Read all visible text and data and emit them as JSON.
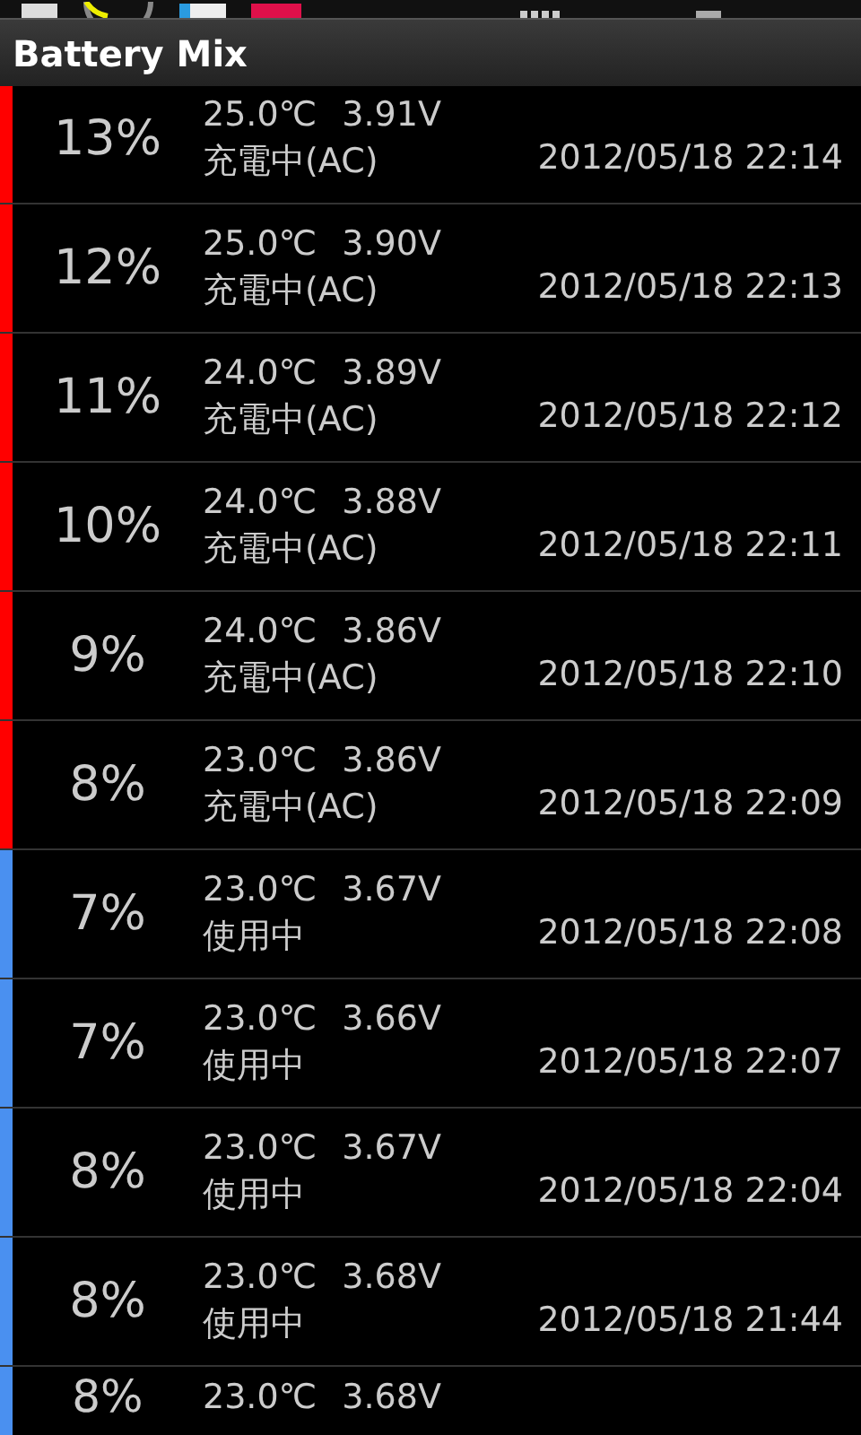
{
  "window": {
    "title": "Battery Mix"
  },
  "records": [
    {
      "percent": "13%",
      "temperature": "25.0℃",
      "voltage": "3.91V",
      "status": "充電中(AC)",
      "time": "2012/05/18 22:14",
      "color": "#ff0000"
    },
    {
      "percent": "12%",
      "temperature": "25.0℃",
      "voltage": "3.90V",
      "status": "充電中(AC)",
      "time": "2012/05/18 22:13",
      "color": "#ff0000"
    },
    {
      "percent": "11%",
      "temperature": "24.0℃",
      "voltage": "3.89V",
      "status": "充電中(AC)",
      "time": "2012/05/18 22:12",
      "color": "#ff0000"
    },
    {
      "percent": "10%",
      "temperature": "24.0℃",
      "voltage": "3.88V",
      "status": "充電中(AC)",
      "time": "2012/05/18 22:11",
      "color": "#ff0000"
    },
    {
      "percent": "9%",
      "temperature": "24.0℃",
      "voltage": "3.86V",
      "status": "充電中(AC)",
      "time": "2012/05/18 22:10",
      "color": "#ff0000"
    },
    {
      "percent": "8%",
      "temperature": "23.0℃",
      "voltage": "3.86V",
      "status": "充電中(AC)",
      "time": "2012/05/18 22:09",
      "color": "#ff0000"
    },
    {
      "percent": "7%",
      "temperature": "23.0℃",
      "voltage": "3.67V",
      "status": "使用中",
      "time": "2012/05/18 22:08",
      "color": "#4a90f0"
    },
    {
      "percent": "7%",
      "temperature": "23.0℃",
      "voltage": "3.66V",
      "status": "使用中",
      "time": "2012/05/18 22:07",
      "color": "#4a90f0"
    },
    {
      "percent": "8%",
      "temperature": "23.0℃",
      "voltage": "3.67V",
      "status": "使用中",
      "time": "2012/05/18 22:04",
      "color": "#4a90f0"
    },
    {
      "percent": "8%",
      "temperature": "23.0℃",
      "voltage": "3.68V",
      "status": "使用中",
      "time": "2012/05/18 21:44",
      "color": "#4a90f0"
    },
    {
      "percent": "8%",
      "temperature": "23.0℃",
      "voltage": "3.68V",
      "color": "#4a90f0"
    }
  ]
}
